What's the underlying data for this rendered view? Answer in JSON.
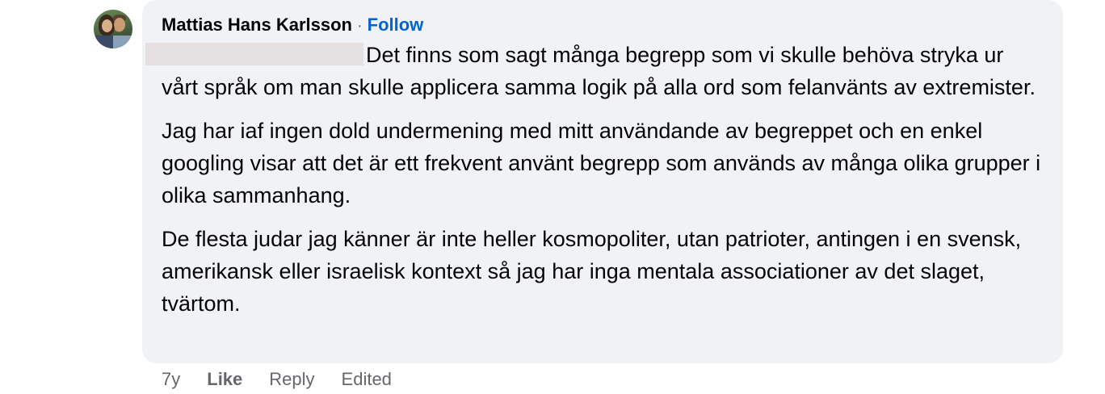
{
  "comment": {
    "author": "Mattias Hans Karlsson",
    "separator": "·",
    "follow_label": "Follow",
    "paragraphs": [
      "Det finns som sagt många begrepp som vi skulle behöva stryka ur vårt språk om man skulle applicera samma logik på alla ord som felanvänts av extremister.",
      "Jag har iaf ingen dold undermening med mitt användande av begreppet och en enkel googling visar att det är ett frekvent använt begrepp som används av många olika grupper i olika sammanhang.",
      "De flesta judar jag känner är inte heller kosmopoliter, utan patrioter, antingen i en svensk, amerikansk eller israelisk kontext så jag har inga mentala associationer av det slaget, tvärtom."
    ],
    "colors": {
      "bubble_background": "#f0f2f5",
      "follow_link": "#0064d1",
      "meta_text": "#65676b",
      "redaction": "#e4dfe0"
    }
  },
  "actions": {
    "age": "7y",
    "like_label": "Like",
    "reply_label": "Reply",
    "edited_label": "Edited"
  }
}
